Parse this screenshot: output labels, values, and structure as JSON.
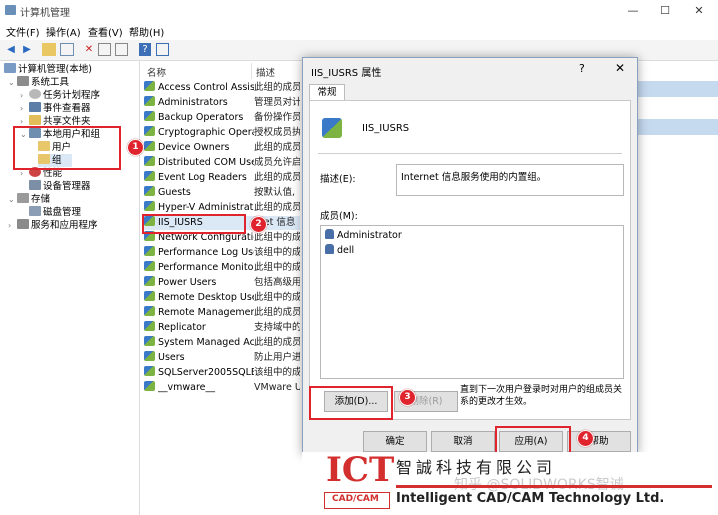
{
  "window": {
    "title": "计算机管理"
  },
  "menu": [
    "文件(F)",
    "操作(A)",
    "查看(V)",
    "帮助(H)"
  ],
  "tree": {
    "root": "计算机管理(本地)",
    "system_tools": "系统工具",
    "task_scheduler": "任务计划程序",
    "event_viewer": "事件查看器",
    "shared_folders": "共享文件夹",
    "local_users_groups": "本地用户和组",
    "users": "用户",
    "groups": "组",
    "performance": "性能",
    "device_manager": "设备管理器",
    "storage": "存储",
    "disk_management": "磁盘管理",
    "services_apps": "服务和应用程序"
  },
  "list": {
    "col_name": "名称",
    "col_desc": "描述",
    "rows": [
      {
        "name": "Access Control Assist...",
        "desc": "此组的成员"
      },
      {
        "name": "Administrators",
        "desc": "管理员对计"
      },
      {
        "name": "Backup Operators",
        "desc": "备份操作员"
      },
      {
        "name": "Cryptographic Operat...",
        "desc": "授权成员执"
      },
      {
        "name": "Device Owners",
        "desc": "此组的成员"
      },
      {
        "name": "Distributed COM Users",
        "desc": "成员允许启"
      },
      {
        "name": "Event Log Readers",
        "desc": "此组的成员"
      },
      {
        "name": "Guests",
        "desc": "按默认值,"
      },
      {
        "name": "Hyper-V Administrat...",
        "desc": "此组的成员"
      },
      {
        "name": "IIS_IUSRS",
        "desc": "rnet 信息"
      },
      {
        "name": "Network Configuratio...",
        "desc": "此组中的成"
      },
      {
        "name": "Performance Log Users",
        "desc": "该组中的成"
      },
      {
        "name": "Performance Monitor...",
        "desc": "此组中的成"
      },
      {
        "name": "Power Users",
        "desc": "包括高级用"
      },
      {
        "name": "Remote Desktop Users",
        "desc": "此组中的成"
      },
      {
        "name": "Remote Managemen...",
        "desc": "此组的成员"
      },
      {
        "name": "Replicator",
        "desc": "支持域中的"
      },
      {
        "name": "System Managed Acc...",
        "desc": "此组的成员"
      },
      {
        "name": "Users",
        "desc": "防止用户进"
      },
      {
        "name": "SQLServer2005SQLB...",
        "desc": "该组中的成"
      },
      {
        "name": "__vmware__",
        "desc": "VMware Us"
      }
    ]
  },
  "dialog": {
    "title": "IIS_IUSRS 属性",
    "help_glyph": "?",
    "close_glyph": "✕",
    "tab": "常规",
    "group_name": "IIS_IUSRS",
    "desc_label": "描述(E):",
    "desc_value": "Internet 信息服务使用的内置组。",
    "members_label": "成员(M):",
    "members": [
      "Administrator",
      "dell"
    ],
    "add_button": "添加(D)...",
    "remove_button": "删除(R)",
    "note": "直到下一次用户登录时对用户的组成员关系的更改才生效。",
    "ok": "确定",
    "cancel": "取消",
    "apply": "应用(A)",
    "help": "帮助"
  },
  "badges": [
    "1",
    "2",
    "3",
    "4"
  ],
  "watermark": {
    "logo_top": "ICT",
    "logo_bottom": "CAD/CAM",
    "cn_name": "智誠科技有限公司",
    "en_name": "Intelligent CAD/CAM Technology Ltd.",
    "zhihu": "知乎 @SOLIDWORKS智诚"
  },
  "colors": {
    "highlight": "#e0242d",
    "selection": "#c5d9ef",
    "brand_red": "#d32f2f"
  }
}
